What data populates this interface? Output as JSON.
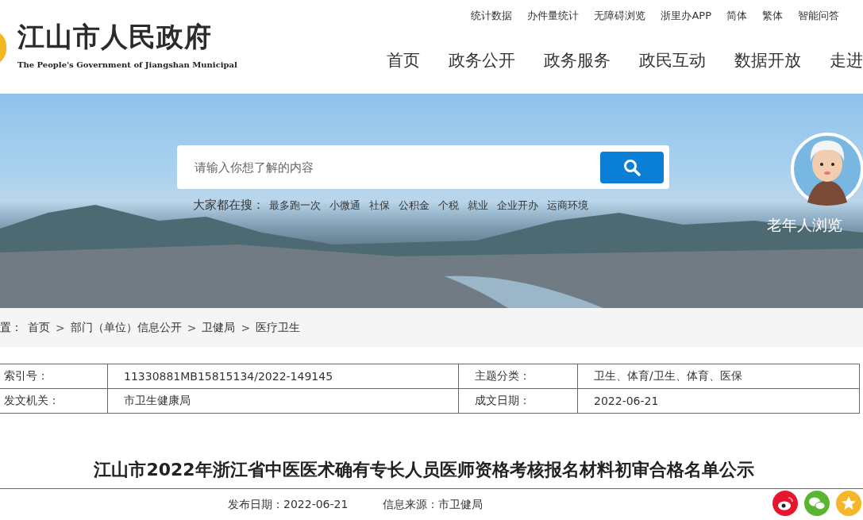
{
  "header": {
    "title": "江山市人民政府",
    "subtitle": "The People's Government of Jiangshan Municipal",
    "top_links": [
      "统计数据",
      "办件量统计",
      "无障碍浏览",
      "浙里办APP",
      "简体",
      "繁体",
      "智能问答"
    ],
    "nav": [
      "首页",
      "政务公开",
      "政务服务",
      "政民互动",
      "数据开放",
      "走进"
    ]
  },
  "banner": {
    "search": {
      "placeholder": "请输入你想了解的内容"
    },
    "hot_label": "大家都在搜：",
    "hot_items": [
      "最多跑一次",
      "小微通",
      "社保",
      "公积金",
      "个税",
      "就业",
      "企业开办",
      "运商环境"
    ],
    "elderly_mode": "老年人浏览"
  },
  "breadcrumb": [
    {
      "kind": "label",
      "text": "置："
    },
    {
      "kind": "link",
      "text": "首页"
    },
    {
      "kind": "sep",
      "text": ">"
    },
    {
      "kind": "link",
      "text": "部门（单位）信息公开"
    },
    {
      "kind": "sep",
      "text": ">"
    },
    {
      "kind": "link",
      "text": "卫健局"
    },
    {
      "kind": "sep",
      "text": ">"
    },
    {
      "kind": "link",
      "text": "医疗卫生"
    }
  ],
  "info_table": {
    "rows": [
      [
        {
          "label": "索引号：",
          "value": "11330881MB15815134/2022-149145"
        },
        {
          "label": "主题分类：",
          "value": "卫生、体育/卫生、体育、医保"
        }
      ],
      [
        {
          "label": "发文机关：",
          "value": "市卫生健康局"
        },
        {
          "label": "成文日期：",
          "value": "2022-06-21"
        }
      ]
    ]
  },
  "article": {
    "title": "江山市2022年浙江省中医医术确有专长人员医师资格考核报名材料初审合格名单公示",
    "meta": [
      "发布日期：2022-06-21",
      "信息来源：市卫健局"
    ]
  }
}
